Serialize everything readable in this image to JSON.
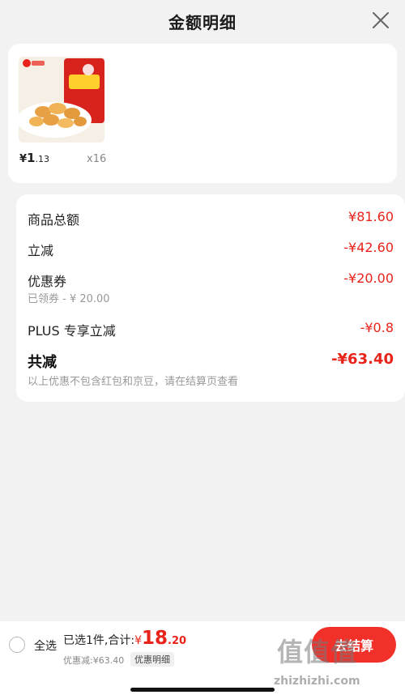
{
  "header": {
    "title": "金额明细",
    "close_icon": "close-icon"
  },
  "product": {
    "image_icon": "snack-package-image",
    "price_yen": "¥",
    "price_int": "1",
    "price_dec": ".13",
    "quantity": "x16"
  },
  "details": {
    "goods_total": {
      "label": "商品总额",
      "value": "¥81.60"
    },
    "instant_off": {
      "label": "立减",
      "value": "-¥42.60"
    },
    "coupon": {
      "label": "优惠券",
      "value": "-¥20.00",
      "sub": "已领券 - ¥ 20.00"
    },
    "plus_off": {
      "label": "PLUS 专享立减",
      "value": "-¥0.8"
    },
    "total_off": {
      "label": "共减",
      "value": "-¥63.40",
      "note": "以上优惠不包含红包和京豆，请在结算页查看"
    }
  },
  "bottom": {
    "select_all": "全选",
    "selected_text": "已选1件,合计:",
    "amount_yen": "¥",
    "amount_int": "18",
    "amount_dec": ".20",
    "discount_line": "优惠减:¥63.40",
    "detail_tag": "优惠明细",
    "checkout": "去结算"
  },
  "watermark": {
    "big": "值值值",
    "small": "zhizhizhi.com"
  },
  "colors": {
    "accent": "#e8231a",
    "button": "#f2302a"
  }
}
